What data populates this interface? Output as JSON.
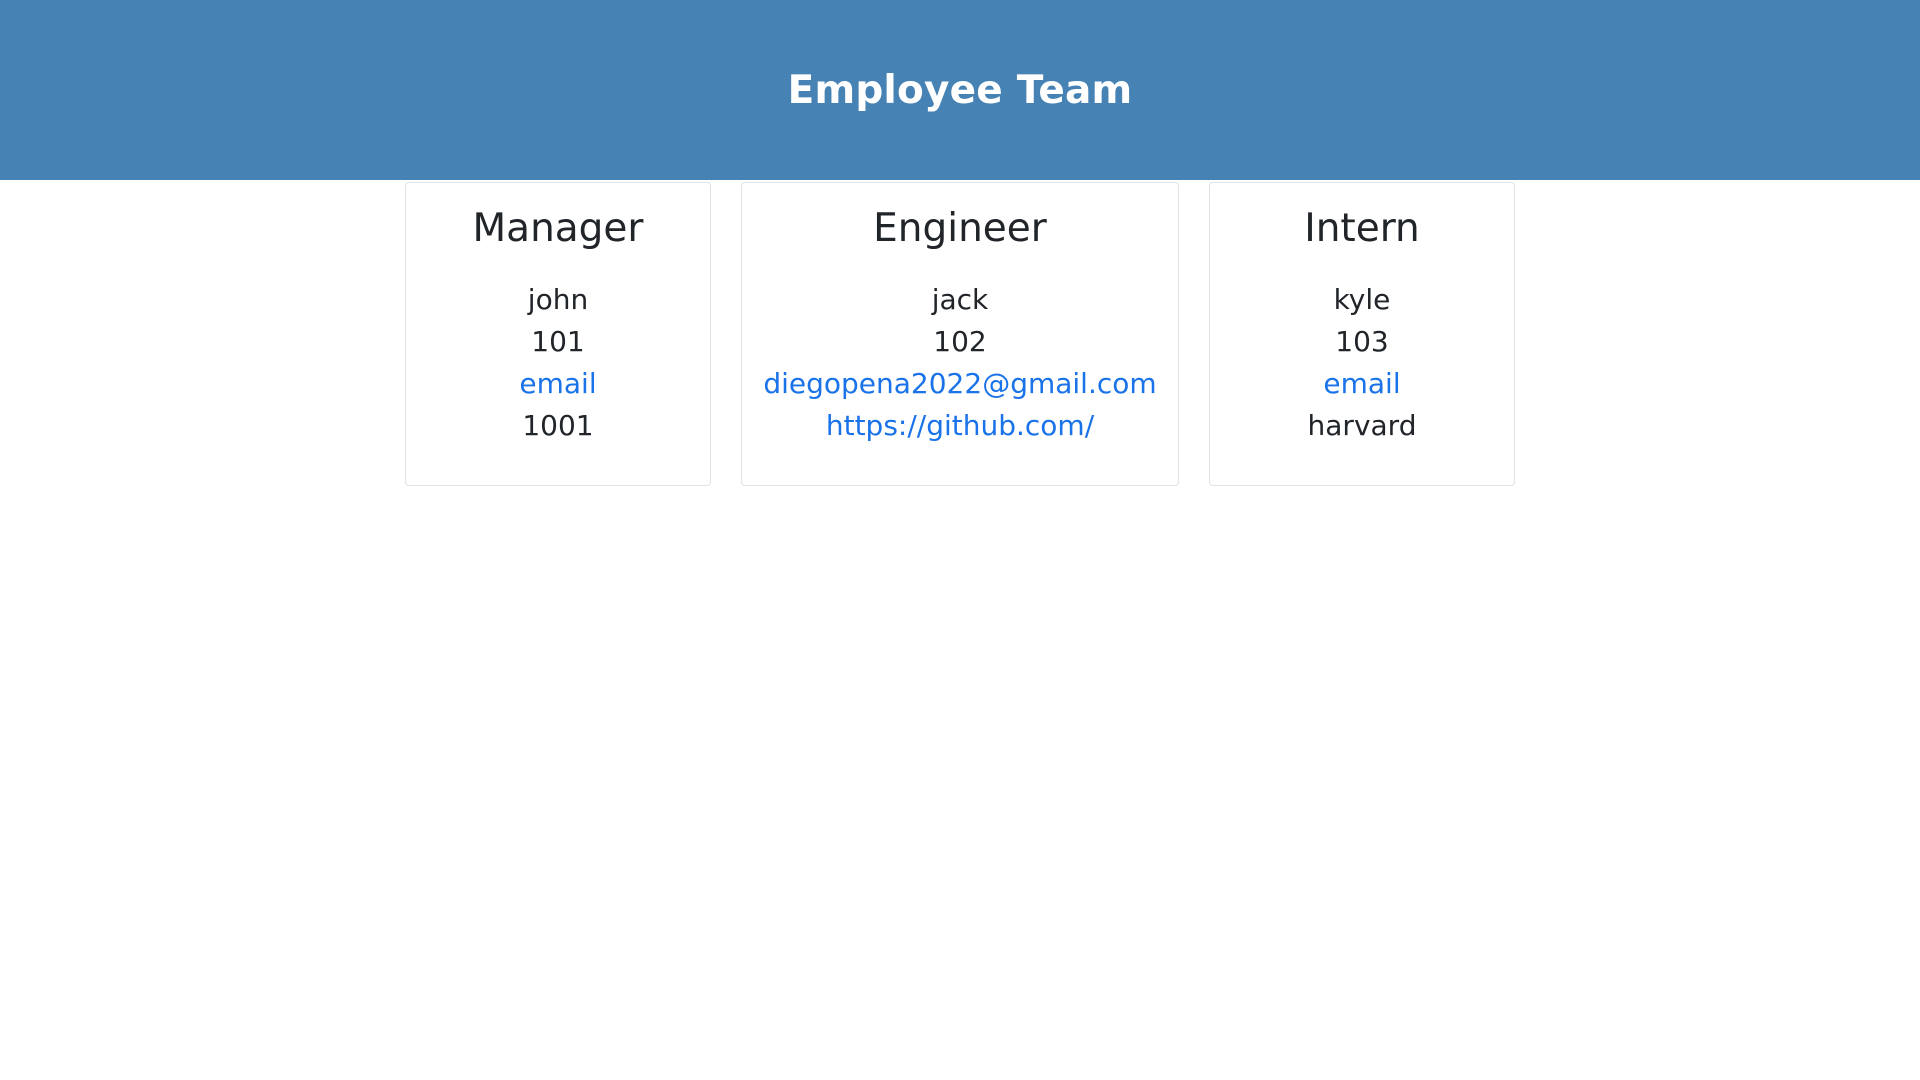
{
  "header": {
    "title": "Employee Team"
  },
  "colors": {
    "header_bg": "#4682b4",
    "link": "#1a73e8"
  },
  "cards": [
    {
      "role": "Manager",
      "name": "john",
      "id": "101",
      "email_label": "email",
      "extra": "1001"
    },
    {
      "role": "Engineer",
      "name": "jack",
      "id": "102",
      "email_label": "diegopena2022@gmail.com",
      "extra": "https://github.com/"
    },
    {
      "role": "Intern",
      "name": "kyle",
      "id": "103",
      "email_label": "email",
      "extra": "harvard"
    }
  ]
}
